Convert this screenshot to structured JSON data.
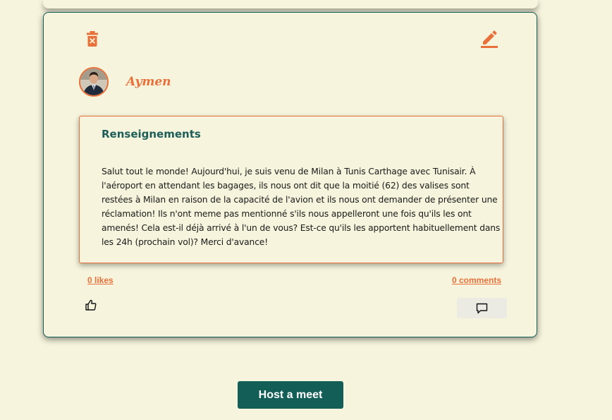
{
  "post": {
    "author": "Aymen",
    "title": "Renseignements",
    "body": "Salut tout le monde! Aujourd'hui, je suis venu de Milan à Tunis Carthage avec Tunisair. À l'aéroport en attendant les bagages, ils nous ont dit que la moitié (62) des valises sont restées à Milan en raison de la capacité de l'avion et ils nous ont demander de présenter une réclamation! Ils n'ont meme pas mentionné s'ils nous appelleront une fois qu'ils les ont amenés! Cela est-il déjà arrivé à l'un de vous? Est-ce qu'ils les apportent habituellement dans les 24h (prochain vol)? Merci d'avance!",
    "likes_label": "0 likes",
    "comments_label": "0 comments",
    "delete_icon": "trash-icon",
    "edit_icon": "pencil-icon",
    "like_icon": "thumbs-up-icon",
    "comment_icon": "comment-icon"
  },
  "actions": {
    "host_label": "Host a meet"
  },
  "colors": {
    "accent": "#e8703a",
    "primary": "#145e58",
    "background": "#f6f4dc"
  }
}
